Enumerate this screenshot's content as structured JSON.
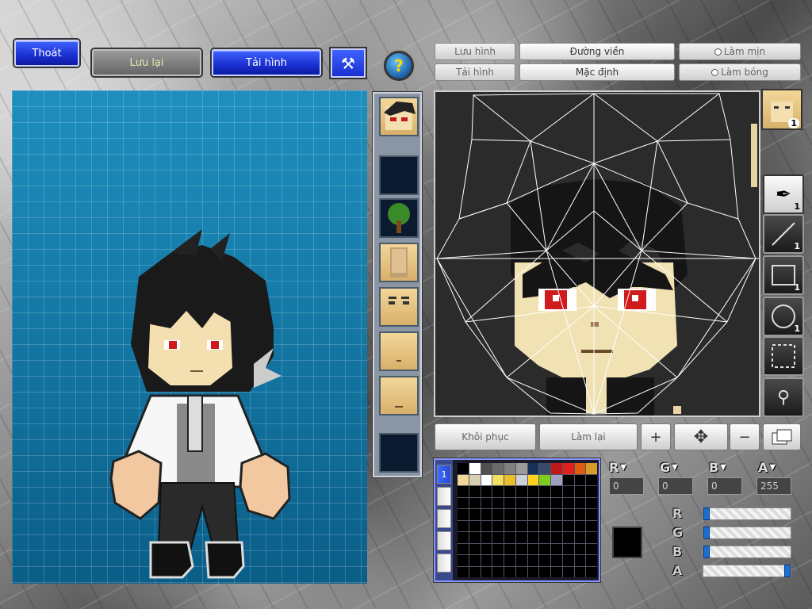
{
  "top_left": {
    "exit_label": "Thoát",
    "save_label": "Lưu lại",
    "reload_label": "Tải hình"
  },
  "help": {
    "glyph": "?"
  },
  "editor_header": {
    "save_image": "Lưu hình",
    "load_image": "Tải hình",
    "outline": "Đường viền",
    "default": "Mặc định",
    "smooth": "Làm mịn",
    "shade": "Làm bóng"
  },
  "tools": {
    "avatar_count": "1",
    "brush_count": "1",
    "line_count": "1",
    "rect_count": "1",
    "ellipse_count": "1"
  },
  "bottom_buttons": {
    "restore": "Khôi phục",
    "redo": "Làm lại"
  },
  "palette": {
    "tab_1": "1",
    "colors": [
      "#000000",
      "#ffffff",
      "#505050",
      "#6a6a6a",
      "#808080",
      "#9a9a9a",
      "#15305a",
      "#3a4a6a",
      "#c0181a",
      "#e0201c",
      "#e05a10",
      "#d89a28",
      "#f2d79a",
      "#d8cfb0",
      "#ffffff",
      "#f4e060",
      "#e8c02a",
      "#cfd0d8",
      "#ffd21f",
      "#7fcb1f",
      "#a0a0c0"
    ]
  },
  "channels": {
    "r_label": "R",
    "g_label": "G",
    "b_label": "B",
    "a_label": "A",
    "r_value": "0",
    "g_value": "0",
    "b_value": "0",
    "a_value": "255"
  },
  "current_color": "#000000",
  "sliders": {
    "r": 0,
    "g": 0,
    "b": 0,
    "a": 255
  }
}
